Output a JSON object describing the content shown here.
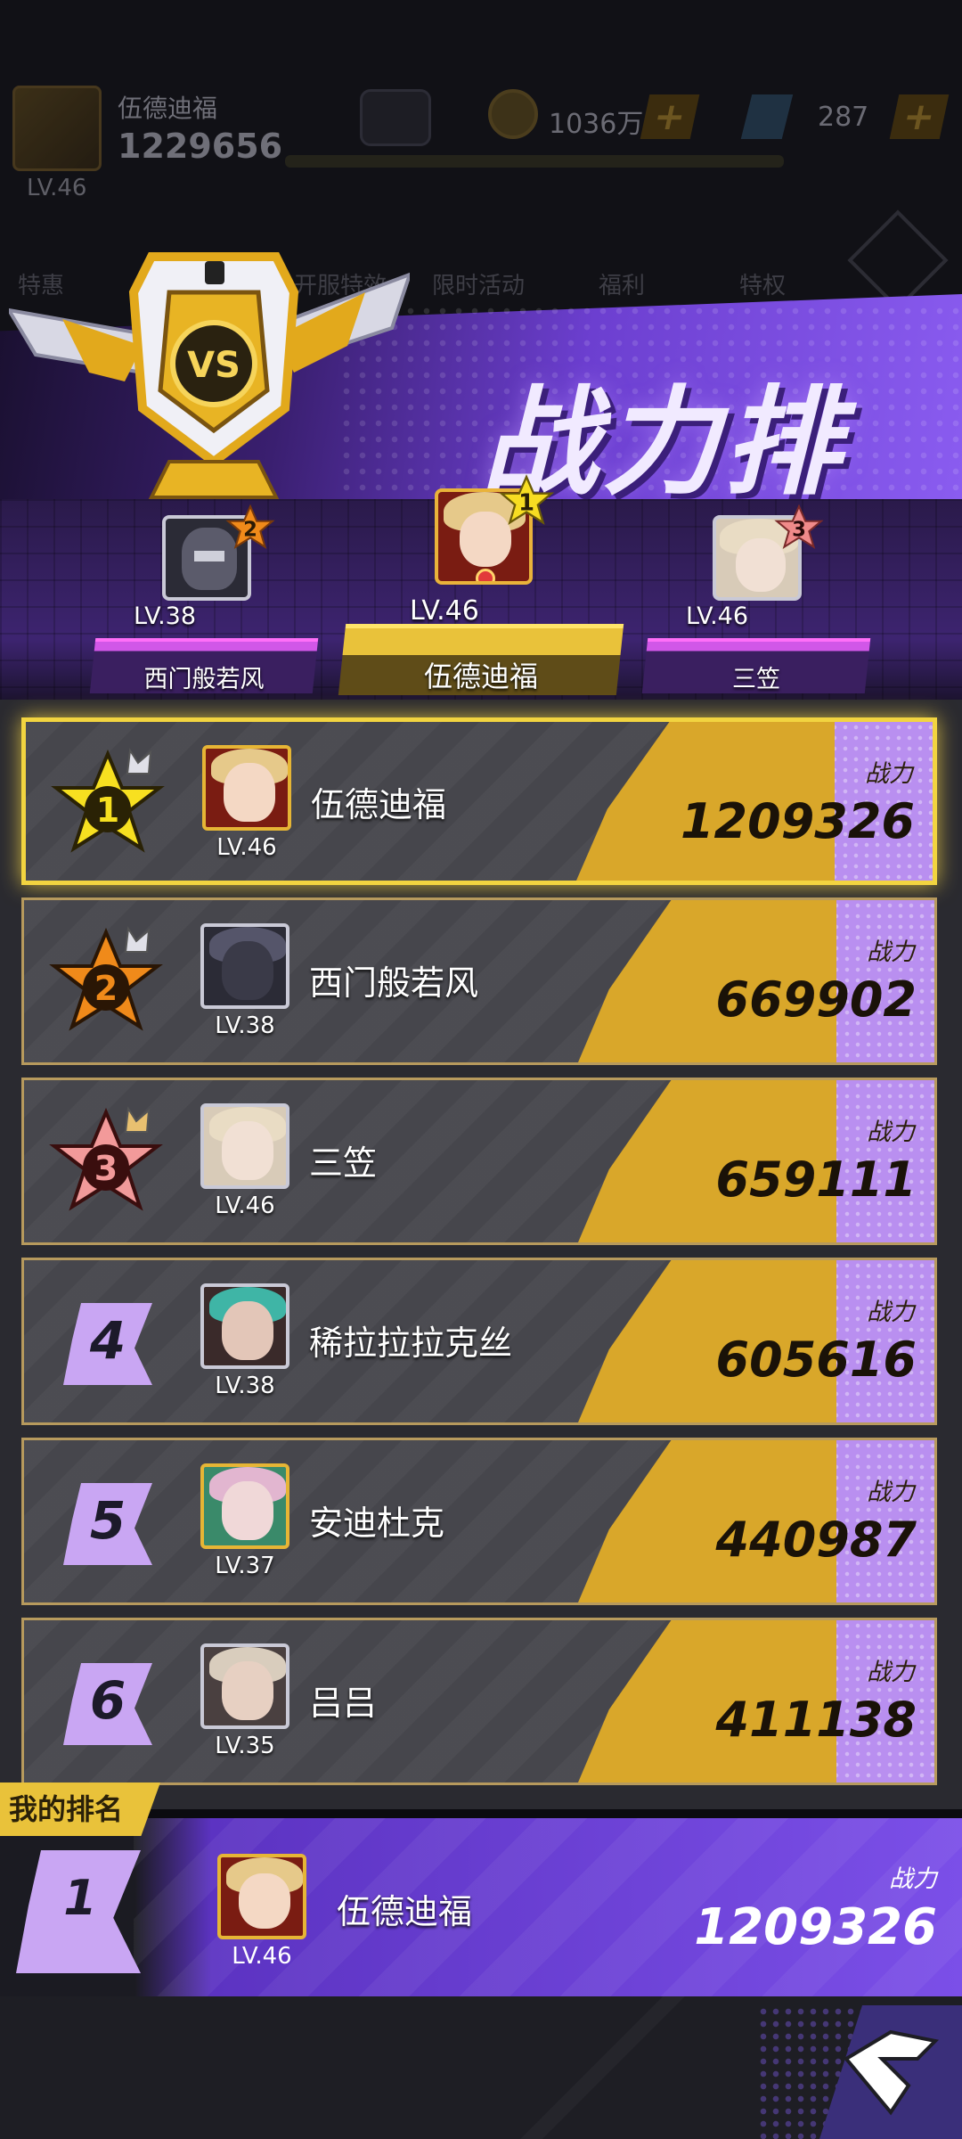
{
  "hud": {
    "player_name": "伍德迪福",
    "player_power": "1229656",
    "player_level": "LV.46",
    "coins": "1036万",
    "gems": "287",
    "menu": [
      "特惠",
      "开服特效",
      "限时活动",
      "福利",
      "特权"
    ]
  },
  "banner": {
    "title": "战力排名"
  },
  "podium": [
    {
      "rank": "2",
      "level": "LV.38",
      "name": "西门般若风"
    },
    {
      "rank": "1",
      "level": "LV.46",
      "name": "伍德迪福"
    },
    {
      "rank": "3",
      "level": "LV.46",
      "name": "三笠"
    }
  ],
  "list": {
    "power_label": "战力",
    "rows": [
      {
        "rank": "1",
        "name": "伍德迪福",
        "level": "LV.46",
        "power": "1209326"
      },
      {
        "rank": "2",
        "name": "西门般若风",
        "level": "LV.38",
        "power": "669902"
      },
      {
        "rank": "3",
        "name": "三笠",
        "level": "LV.46",
        "power": "659111"
      },
      {
        "rank": "4",
        "name": "稀拉拉拉克丝",
        "level": "LV.38",
        "power": "605616"
      },
      {
        "rank": "5",
        "name": "安迪杜克",
        "level": "LV.37",
        "power": "440987"
      },
      {
        "rank": "6",
        "name": "吕吕",
        "level": "LV.35",
        "power": "411138"
      }
    ]
  },
  "my_rank": {
    "tag": "我的排名",
    "rank": "1",
    "name": "伍德迪福",
    "level": "LV.46",
    "power_label": "战力",
    "power": "1209326"
  },
  "colors": {
    "gold": "#e9c23a",
    "purple": "#7b4fe8",
    "row_bg": "#46464c"
  }
}
